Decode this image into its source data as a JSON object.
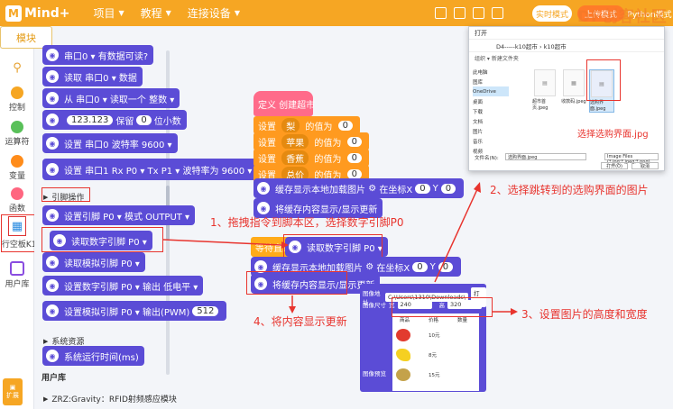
{
  "app": {
    "logo_text": "Mind+",
    "menu": [
      "项目",
      "教程",
      "连接设备"
    ],
    "modes": [
      "实时模式",
      "上传模式",
      "Python模式"
    ],
    "watermark": "DF创客社区"
  },
  "left_tab": "模块",
  "categories": [
    {
      "label": "控制",
      "color": "#f6a623"
    },
    {
      "label": "运算符",
      "color": "#59c059"
    },
    {
      "label": "变量",
      "color": "#ff8c1a"
    },
    {
      "label": "函数",
      "color": "#ff6680"
    },
    {
      "label": "行空板K10"
    },
    {
      "label": "用户库"
    }
  ],
  "extension_label": "扩展",
  "palette": {
    "blocks": [
      {
        "text": "串口0 ▾ 有数据可读?"
      },
      {
        "text": "读取 串口0 ▾ 数据"
      },
      {
        "text": "从 串口0 ▾ 读取一个 整数 ▾"
      },
      {
        "prefix": "123.123",
        "mid": "保留",
        "num": "0",
        "suffix": "位小数"
      },
      {
        "text": "设置 串口0 波特率 9600 ▾"
      },
      {
        "text": "设置 串口1 Rx P0 ▾ Tx P1 ▾ 波特率为 9600 ▾"
      },
      {
        "text": "设置引脚 P0 ▾ 模式 OUTPUT ▾"
      },
      {
        "text": "读取数字引脚 P0 ▾"
      },
      {
        "text": "读取模拟引脚 P0 ▾"
      },
      {
        "text": "设置数字引脚 P0 ▾ 输出 低电平 ▾"
      },
      {
        "text": "设置模拟引脚 P0 ▾ 输出(PWM)",
        "num": "512"
      },
      {
        "text": "系统运行时间(ms)"
      }
    ],
    "section_pin": "引脚操作",
    "section_system": "系统资源",
    "section_userlib": "用户库",
    "section_rfid": "ZRZ:Gravity：RFID射频感应模块"
  },
  "script": {
    "define": "定义 创建超市",
    "sets": [
      {
        "var": "梨",
        "val": "0"
      },
      {
        "var": "苹果",
        "val": "0"
      },
      {
        "var": "香蕉",
        "val": "0"
      },
      {
        "var": "总价",
        "val": "0"
      }
    ],
    "set_prefix": "设置",
    "set_mid": "的值为",
    "cache_img": "缓存显示本地加载图片",
    "at_coord": "在坐标X",
    "x_val": "0",
    "y_label": "Y",
    "y_val": "0",
    "cache_show": "将缓存内容显示/显示更新",
    "wait_until": "等待直到",
    "read_pin": "读取数字引脚 P0 ▾"
  },
  "dialog": {
    "title": "打开",
    "address": "D4-----k10超市 › k10超市",
    "toolbar": "组织 ▾    新建文件夹",
    "sidebar": [
      "此电脑",
      "图库",
      "OneDrive",
      "桌面",
      "下载",
      "文档",
      "图片",
      "音乐",
      "视频"
    ],
    "files": [
      "超市首页.jpeg",
      "收款码.jpeg",
      "选购界面.jpeg"
    ],
    "filename_label": "文件名(N):",
    "filename_value": "选购界面.jpeg",
    "filetype_value": "Image Files (*.jpg;*.jpeg;*.png)",
    "open_btn": "打开(O)",
    "cancel_btn": "取消"
  },
  "panel": {
    "addr_label": "图像地址",
    "addr_value": "C:\\Users\\1310\\Downloads\\",
    "open_label": "打开",
    "size_label": "图像尺寸",
    "w_label": "宽",
    "w_value": "240",
    "h_label": "高",
    "h_value": "320",
    "preview_label": "图像预览",
    "col_product": "商品",
    "col_price": "价格",
    "col_qty": "数量",
    "prices": [
      "10元",
      "8元",
      "15元"
    ]
  },
  "annotations": {
    "step1": "1、拖拽指令到脚本区，选择数字引脚P0",
    "step2": "2、选择跳转到的选购界面的图片",
    "step3": "3、设置图片的高度和宽度",
    "step4": "4、将内容显示更新",
    "dialog_note": "选择选购界面.jpg",
    "color": "#e8342e"
  }
}
